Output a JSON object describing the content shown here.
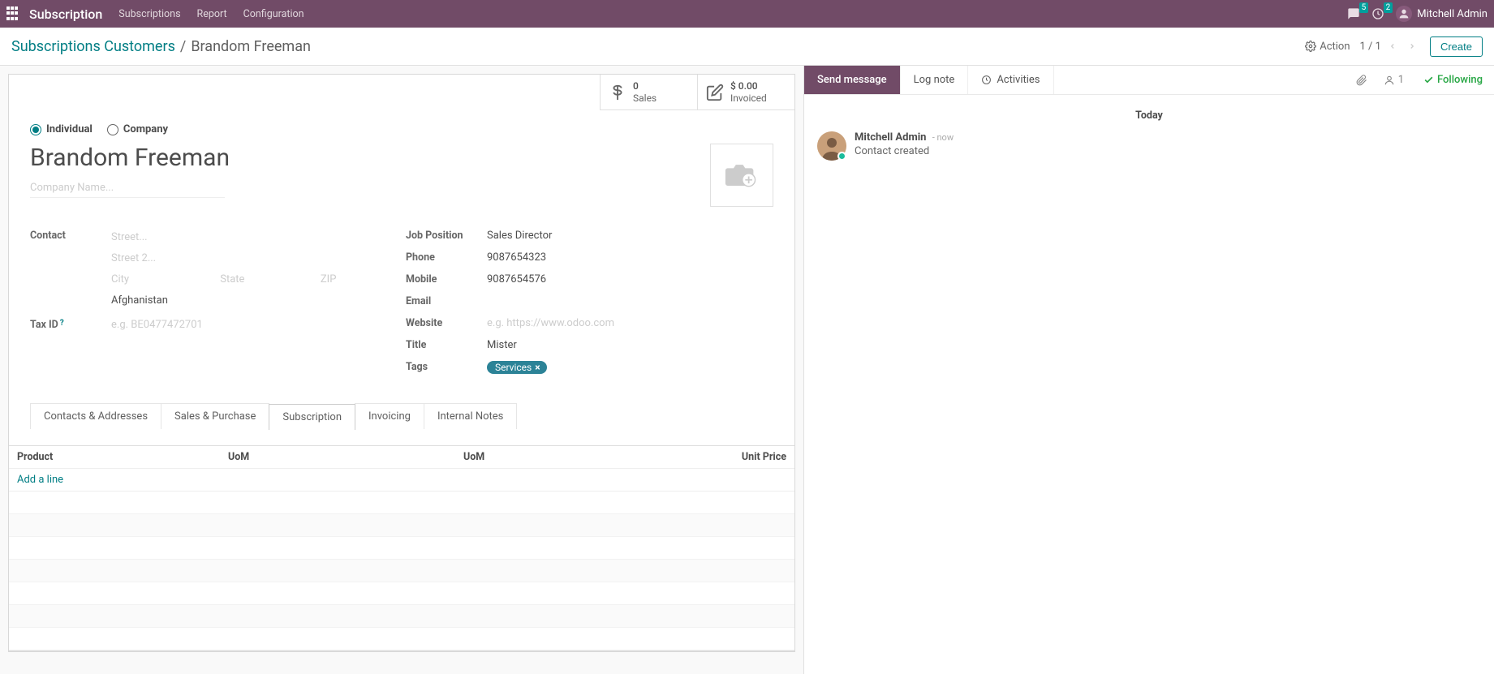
{
  "nav": {
    "brand": "Subscription",
    "links": [
      "Subscriptions",
      "Report",
      "Configuration"
    ],
    "discuss_badge": "5",
    "activity_badge": "2",
    "username": "Mitchell Admin"
  },
  "control": {
    "breadcrumb_link": "Subscriptions Customers",
    "breadcrumb_current": "Brandom Freeman",
    "action_label": "Action",
    "pager": "1 / 1",
    "create_label": "Create"
  },
  "stats": {
    "sales_value": "0",
    "sales_label": "Sales",
    "invoiced_value": "$ 0.00",
    "invoiced_label": "Invoiced"
  },
  "radio": {
    "individual": "Individual",
    "company": "Company"
  },
  "record": {
    "name": "Brandom Freeman",
    "company_placeholder": "Company Name..."
  },
  "left_labels": {
    "contact": "Contact",
    "tax_id": "Tax ID"
  },
  "address": {
    "street_ph": "Street...",
    "street2_ph": "Street 2...",
    "city_ph": "City",
    "state_ph": "State",
    "zip_ph": "ZIP",
    "country": "Afghanistan"
  },
  "tax_placeholder": "e.g. BE0477472701",
  "right_fields": {
    "job_label": "Job Position",
    "job_val": "Sales Director",
    "phone_label": "Phone",
    "phone_val": "9087654323",
    "mobile_label": "Mobile",
    "mobile_val": "9087654576",
    "email_label": "Email",
    "email_val": "",
    "website_label": "Website",
    "website_ph": "e.g. https://www.odoo.com",
    "title_label": "Title",
    "title_val": "Mister",
    "tags_label": "Tags",
    "tags_val": "Services"
  },
  "tabs": [
    "Contacts & Addresses",
    "Sales & Purchase",
    "Subscription",
    "Invoicing",
    "Internal Notes"
  ],
  "active_tab": "Subscription",
  "table": {
    "col_product": "Product",
    "col_uom1": "UoM",
    "col_uom2": "UoM",
    "col_price": "Unit Price",
    "add_line": "Add a line"
  },
  "chatter": {
    "send": "Send message",
    "lognote": "Log note",
    "activities": "Activities",
    "follower_count": "1",
    "following": "Following",
    "day": "Today",
    "author": "Mitchell Admin",
    "timestamp": "now",
    "body": "Contact created"
  }
}
